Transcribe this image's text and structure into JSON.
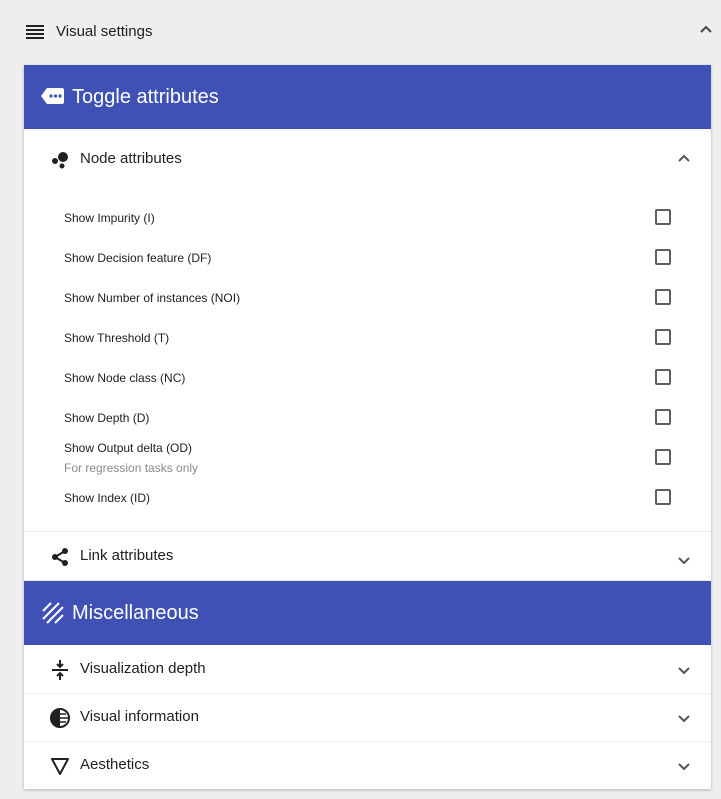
{
  "header": {
    "title": "Visual settings",
    "menu_icon": "menu-icon",
    "collapse_icon": "chevron-up-icon"
  },
  "toggle_section": {
    "title": "Toggle attributes",
    "icon": "label-dots-icon",
    "node_panel": {
      "label": "Node attributes",
      "icon": "bubbles-icon",
      "expanded": true,
      "attributes": [
        {
          "label": "Show Impurity (I)",
          "hint": "",
          "checked": false
        },
        {
          "label": "Show Decision feature (DF)",
          "hint": "",
          "checked": false
        },
        {
          "label": "Show Number of instances (NOI)",
          "hint": "",
          "checked": false
        },
        {
          "label": "Show Threshold (T)",
          "hint": "",
          "checked": false
        },
        {
          "label": "Show Node class (NC)",
          "hint": "",
          "checked": false
        },
        {
          "label": "Show Depth (D)",
          "hint": "",
          "checked": false
        },
        {
          "label": "Show Output delta (OD)",
          "hint": "For regression tasks only",
          "checked": false
        },
        {
          "label": "Show Index (ID)",
          "hint": "",
          "checked": false
        }
      ]
    },
    "link_panel": {
      "label": "Link attributes",
      "icon": "share-icon",
      "expanded": false
    }
  },
  "misc_section": {
    "title": "Miscellaneous",
    "icon": "texture-icon",
    "panels": [
      {
        "label": "Visualization depth",
        "icon": "vertical-align-center-icon",
        "expanded": false
      },
      {
        "label": "Visual information",
        "icon": "contrast-circle-icon",
        "expanded": false
      },
      {
        "label": "Aesthetics",
        "icon": "triangle-down-outline-icon",
        "expanded": false
      }
    ]
  },
  "colors": {
    "accent": "#3f51b5",
    "background": "#eeeeee",
    "card": "#ffffff",
    "hint_text": "#8a8a8a"
  }
}
